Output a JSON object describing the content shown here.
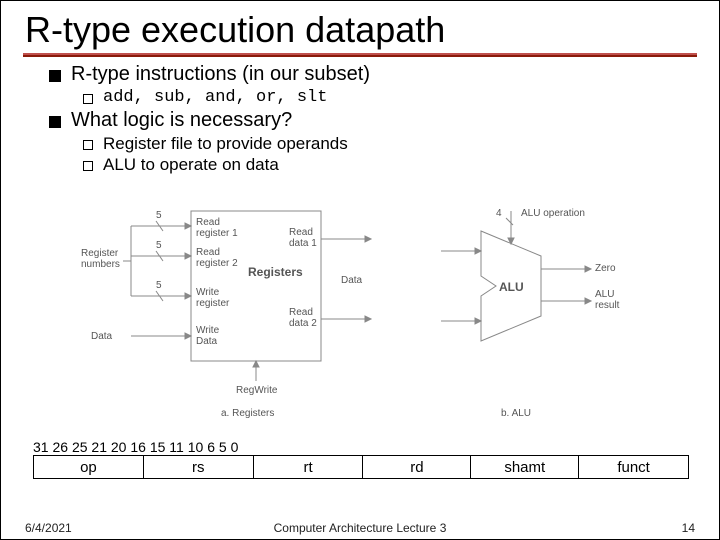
{
  "title": "R-type execution datapath",
  "bullets": {
    "b1a": "R-type instructions (in our subset)",
    "b2a": "add, sub, and, or, slt",
    "b1b": "What logic is necessary?",
    "b2b": "Register file to provide operands",
    "b2c": "ALU to operate on data"
  },
  "diagram": {
    "register_numbers_label": "Register",
    "register_numbers_label2": "numbers",
    "data_label": "Data",
    "read_reg1": "Read",
    "read_reg1b": "register 1",
    "read_reg2": "Read",
    "read_reg2b": "register 2",
    "write_reg": "Write",
    "write_regb": "register",
    "write_data": "Write",
    "write_datab": "Data",
    "registers_label": "Registers",
    "read_data1": "Read",
    "read_data1b": "data 1",
    "read_data2": "Read",
    "read_data2b": "data 2",
    "regwrite": "RegWrite",
    "bus5a": "5",
    "bus5b": "5",
    "bus5c": "5",
    "caption_a": "a. Registers",
    "alu_op_label": "ALU operation",
    "alu_op_width": "4",
    "data_in": "Data",
    "alu_label": "ALU",
    "zero_label": "Zero",
    "alu_result": "ALU",
    "alu_resultb": "result",
    "caption_b": "b. ALU"
  },
  "bitfields": {
    "nums": {
      "n31": "31",
      "n26": "26",
      "n25": "25",
      "n21": "21",
      "n20": "20",
      "n16": "16",
      "n15": "15",
      "n11": "11",
      "n10": "10",
      "n6": "6",
      "n5": "5",
      "n0": "0"
    },
    "fields": {
      "op": "op",
      "rs": "rs",
      "rt": "rt",
      "rd": "rd",
      "shamt": "shamt",
      "funct": "funct"
    }
  },
  "footer": {
    "date": "6/4/2021",
    "center": "Computer Architecture Lecture 3",
    "page": "14"
  }
}
